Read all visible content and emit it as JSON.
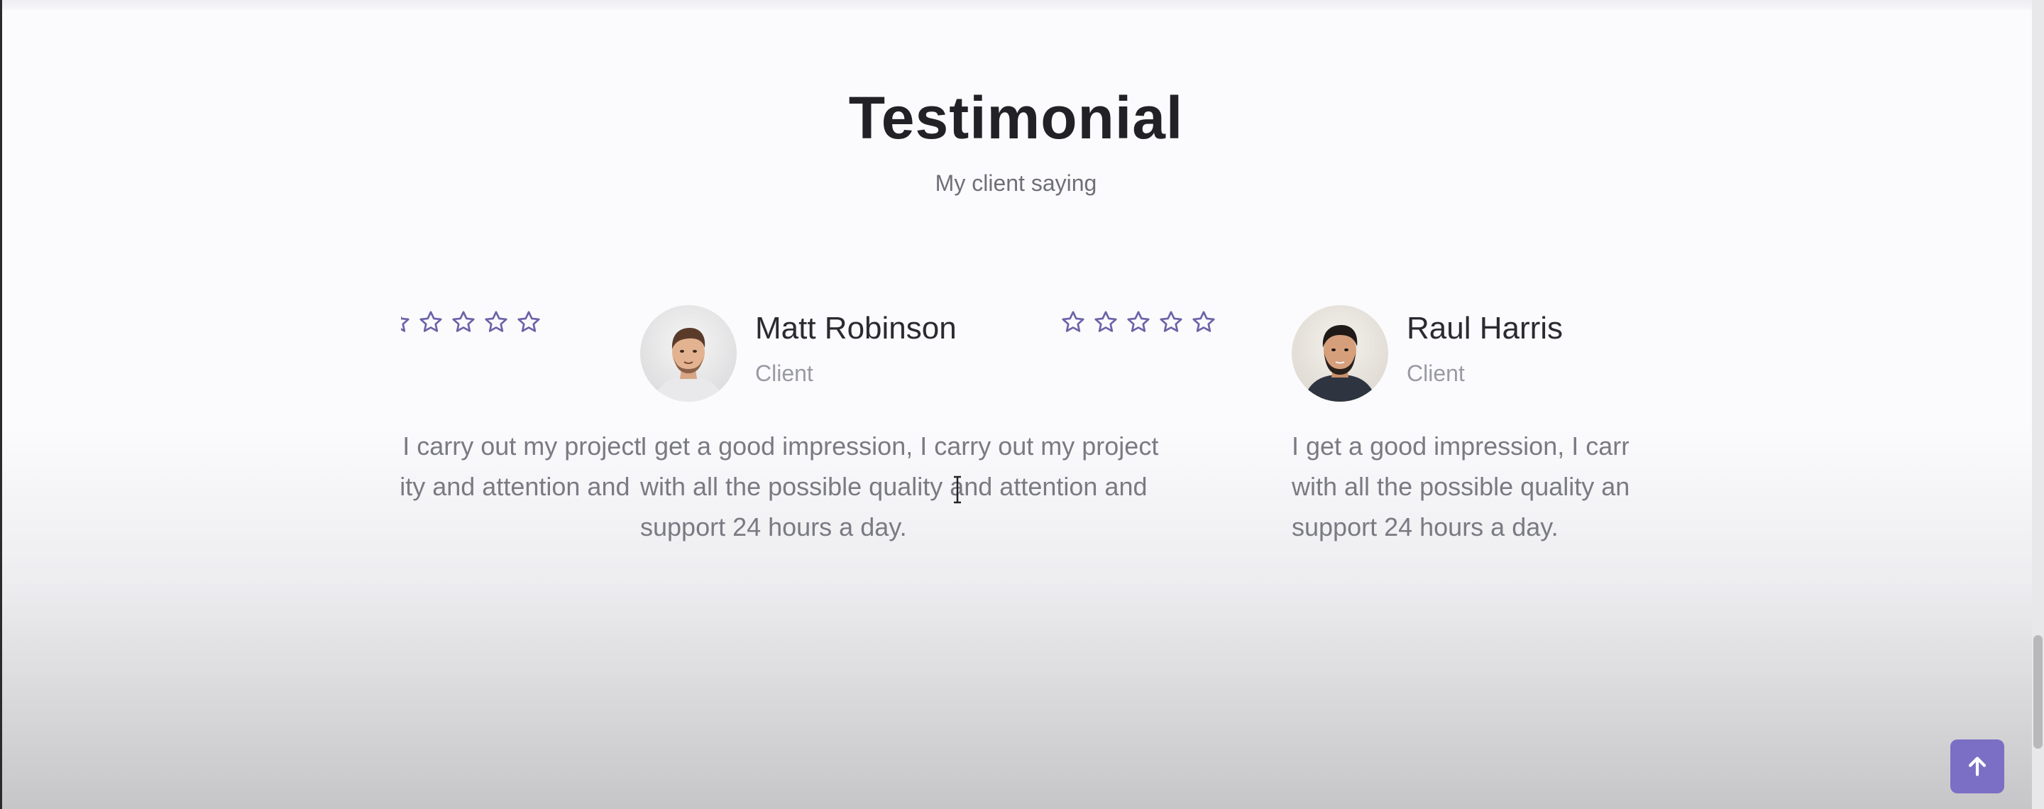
{
  "section": {
    "title": "Testimonial",
    "subtitle": "My client saying"
  },
  "testimonials": [
    {
      "name": "",
      "role": "",
      "rating": 5,
      "quote": "I get a good impression, I carry out my project with all the possible quality and attention and support 24 hours a day."
    },
    {
      "name": "Matt Robinson",
      "role": "Client",
      "rating": 5,
      "quote": "I get a good impression, I carry out my project with all the possible quality and attention and support 24 hours a day."
    },
    {
      "name": "Raul Harris",
      "role": "Client",
      "rating": 5,
      "quote": "I get a good impression, I carry out my project with all the possible quality and attention and support 24 hours a day."
    }
  ],
  "icons": {
    "star": "star-outline-icon",
    "scroll_top": "arrow-up-icon"
  },
  "colors": {
    "accent": "#7a6fc4",
    "star": "#6b63a8",
    "title": "#222226",
    "text_muted": "#7a7a83"
  }
}
